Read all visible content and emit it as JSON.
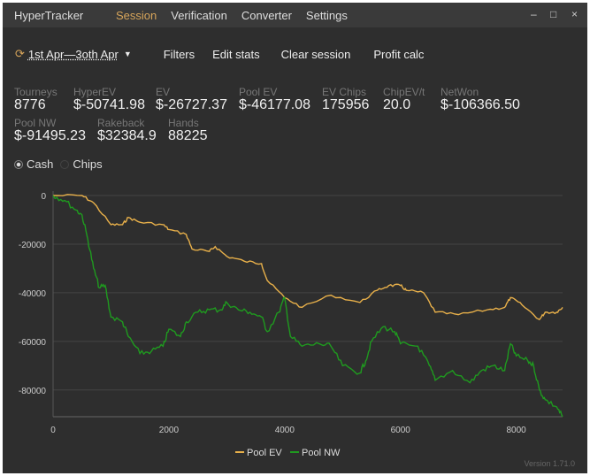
{
  "window": {
    "title": "HyperTracker",
    "nav": [
      "Session",
      "Verification",
      "Converter",
      "Settings"
    ],
    "active": "Session",
    "controls": {
      "minimize": "–",
      "maximize": "□",
      "close": "×"
    }
  },
  "toolbar": {
    "date_range": "1st Apr—3oth Apr",
    "buttons": [
      "Filters",
      "Edit stats",
      "Clear session",
      "Profit calc"
    ]
  },
  "stats": [
    {
      "label": "Tourneys",
      "value": "8776"
    },
    {
      "label": "HyperEV",
      "value": "$-50741.98"
    },
    {
      "label": "EV",
      "value": "$-26727.37"
    },
    {
      "label": "Pool EV",
      "value": "$-46177.08"
    },
    {
      "label": "EV Chips",
      "value": "175956"
    },
    {
      "label": "ChipEV/t",
      "value": "20.0"
    },
    {
      "label": "NetWon",
      "value": "$-106366.50"
    },
    {
      "label": "Pool NW",
      "value": "$-91495.23"
    },
    {
      "label": "Rakeback",
      "value": "$32384.9"
    },
    {
      "label": "Hands",
      "value": "88225"
    }
  ],
  "radios": {
    "options": [
      "Cash",
      "Chips"
    ],
    "selected": "Cash"
  },
  "version": "Version 1.71.0",
  "colors": {
    "accent": "#d6a45a",
    "pool_ev": "#e8b04a",
    "pool_nw": "#1f9a1f"
  },
  "chart_data": {
    "type": "line",
    "xlim": [
      0,
      8800
    ],
    "ylim": [
      -91000,
      0
    ],
    "xticks": [
      0,
      2000,
      4000,
      6000,
      8000
    ],
    "yticks": [
      0,
      -20000,
      -40000,
      -60000,
      -80000
    ],
    "legend": "bottom",
    "series": [
      {
        "name": "Pool EV",
        "points": [
          [
            0,
            0
          ],
          [
            500,
            0
          ],
          [
            700,
            -3000
          ],
          [
            1000,
            -12000
          ],
          [
            1200,
            -12000
          ],
          [
            1300,
            -9000
          ],
          [
            1500,
            -11000
          ],
          [
            1900,
            -12000
          ],
          [
            2000,
            -14000
          ],
          [
            2300,
            -16000
          ],
          [
            2400,
            -22000
          ],
          [
            2700,
            -23000
          ],
          [
            2800,
            -21000
          ],
          [
            3000,
            -25000
          ],
          [
            3300,
            -27000
          ],
          [
            3600,
            -28000
          ],
          [
            3700,
            -35000
          ],
          [
            4000,
            -42000
          ],
          [
            4300,
            -46000
          ],
          [
            4800,
            -41000
          ],
          [
            5300,
            -44000
          ],
          [
            5600,
            -39000
          ],
          [
            5800,
            -37000
          ],
          [
            6000,
            -37000
          ],
          [
            6100,
            -39000
          ],
          [
            6400,
            -40000
          ],
          [
            6600,
            -48000
          ],
          [
            7000,
            -49000
          ],
          [
            7500,
            -47000
          ],
          [
            7800,
            -46000
          ],
          [
            7900,
            -42000
          ],
          [
            8100,
            -45000
          ],
          [
            8400,
            -51000
          ],
          [
            8500,
            -48000
          ],
          [
            8700,
            -48000
          ],
          [
            8800,
            -46000
          ]
        ]
      },
      {
        "name": "Pool NW",
        "points": [
          [
            0,
            0
          ],
          [
            200,
            -2000
          ],
          [
            400,
            -6000
          ],
          [
            500,
            -8000
          ],
          [
            600,
            -18000
          ],
          [
            700,
            -30000
          ],
          [
            800,
            -38000
          ],
          [
            900,
            -37000
          ],
          [
            1000,
            -50000
          ],
          [
            1200,
            -52000
          ],
          [
            1300,
            -58000
          ],
          [
            1500,
            -65000
          ],
          [
            1700,
            -64000
          ],
          [
            1900,
            -62000
          ],
          [
            2000,
            -55000
          ],
          [
            2200,
            -58000
          ],
          [
            2300,
            -52000
          ],
          [
            2500,
            -48000
          ],
          [
            2700,
            -47000
          ],
          [
            2900,
            -47000
          ],
          [
            3000,
            -44000
          ],
          [
            3200,
            -47000
          ],
          [
            3400,
            -48000
          ],
          [
            3600,
            -50000
          ],
          [
            3700,
            -56000
          ],
          [
            3900,
            -48000
          ],
          [
            4000,
            -42000
          ],
          [
            4100,
            -58000
          ],
          [
            4300,
            -62000
          ],
          [
            4600,
            -61000
          ],
          [
            4800,
            -62000
          ],
          [
            5000,
            -70000
          ],
          [
            5300,
            -73000
          ],
          [
            5400,
            -68000
          ],
          [
            5500,
            -60000
          ],
          [
            5700,
            -54000
          ],
          [
            5900,
            -56000
          ],
          [
            6000,
            -61000
          ],
          [
            6300,
            -62000
          ],
          [
            6500,
            -70000
          ],
          [
            6600,
            -76000
          ],
          [
            6900,
            -72000
          ],
          [
            7200,
            -77000
          ],
          [
            7400,
            -72000
          ],
          [
            7600,
            -70000
          ],
          [
            7800,
            -72000
          ],
          [
            7900,
            -61000
          ],
          [
            8000,
            -66000
          ],
          [
            8200,
            -68000
          ],
          [
            8300,
            -70000
          ],
          [
            8400,
            -80000
          ],
          [
            8500,
            -84000
          ],
          [
            8700,
            -87000
          ],
          [
            8800,
            -91000
          ]
        ]
      }
    ]
  }
}
